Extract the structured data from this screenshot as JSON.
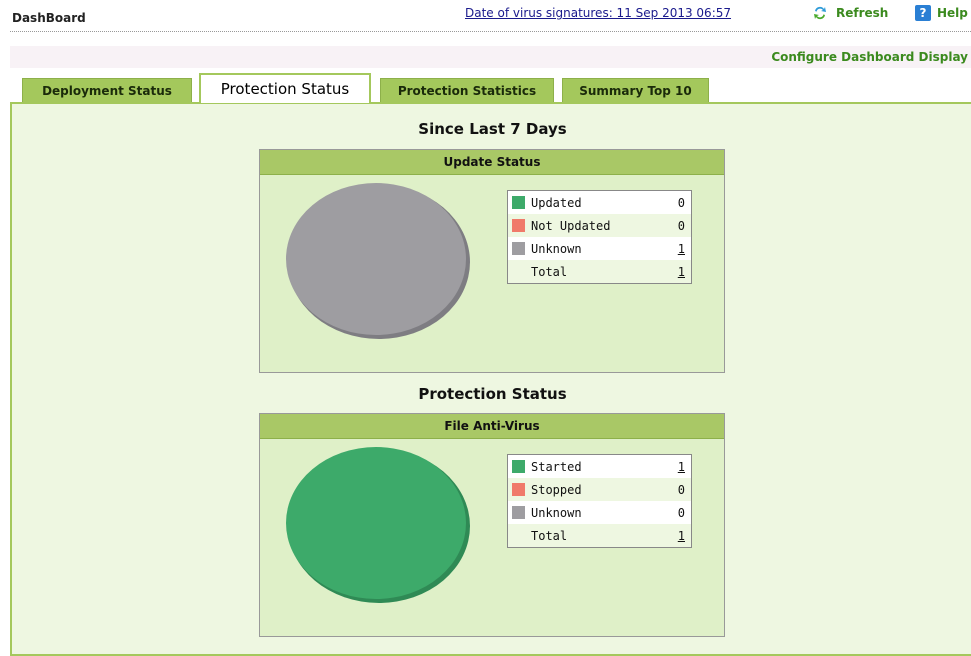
{
  "header": {
    "title": "DashBoard",
    "signature_link": "Date of virus signatures: 11 Sep 2013 06:57",
    "refresh_label": "Refresh",
    "help_label": "Help",
    "help_icon_glyph": "?"
  },
  "config_link": "Configure Dashboard Display",
  "tabs": [
    {
      "label": "Deployment Status",
      "active": false
    },
    {
      "label": "Protection Status",
      "active": true
    },
    {
      "label": "Protection Statistics",
      "active": false
    },
    {
      "label": "Summary Top 10",
      "active": false
    }
  ],
  "colors": {
    "updated_started": "#3daa6a",
    "not_updated_stopped": "#f07a6a",
    "unknown": "#9e9da1",
    "accent": "#a4c85c"
  },
  "sections": [
    {
      "title": "Since Last 7 Days",
      "box_title": "Update Status",
      "legend": [
        {
          "label": "Updated",
          "value": "0",
          "color": "#3daa6a",
          "link": false
        },
        {
          "label": "Not Updated",
          "value": "0",
          "color": "#f07a6a",
          "link": false
        },
        {
          "label": "Unknown",
          "value": "1",
          "color": "#9e9da1",
          "link": true
        },
        {
          "label": "Total",
          "value": "1",
          "color": "",
          "link": true
        }
      ]
    },
    {
      "title": "Protection Status",
      "box_title": "File Anti-Virus",
      "legend": [
        {
          "label": "Started",
          "value": "1",
          "color": "#3daa6a",
          "link": true
        },
        {
          "label": "Stopped",
          "value": "0",
          "color": "#f07a6a",
          "link": false
        },
        {
          "label": "Unknown",
          "value": "0",
          "color": "#9e9da1",
          "link": false
        },
        {
          "label": "Total",
          "value": "1",
          "color": "",
          "link": true
        }
      ]
    }
  ]
}
